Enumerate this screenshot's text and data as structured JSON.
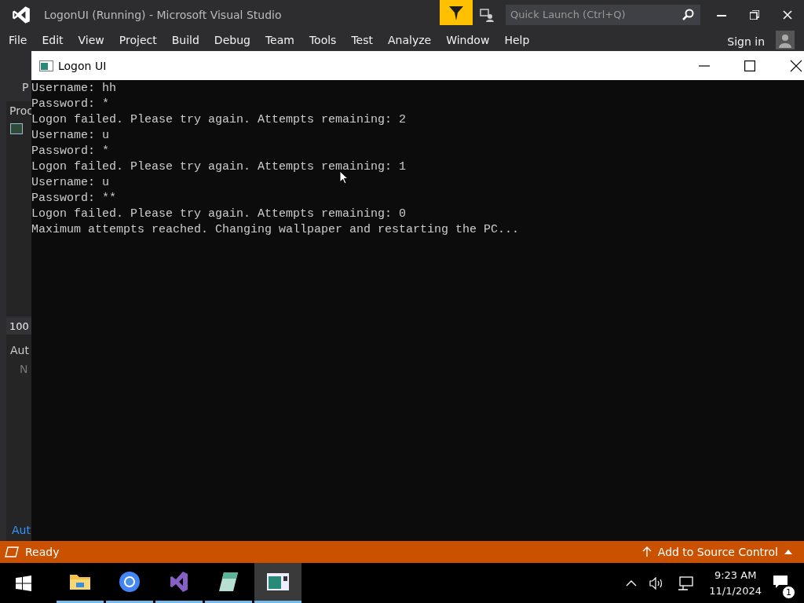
{
  "ide_window": {
    "title": "LogonUI (Running) - Microsoft Visual Studio",
    "quick_launch": {
      "placeholder": "Quick Launch (Ctrl+Q)"
    },
    "menu": [
      "File",
      "Edit",
      "View",
      "Project",
      "Build",
      "Debug",
      "Team",
      "Tools",
      "Test",
      "Analyze",
      "Window",
      "Help"
    ],
    "sign_in": "Sign in",
    "side_panel": {
      "toolbar_text": "P",
      "tab": "Proc",
      "zoom": "100",
      "autos_title": "Aut",
      "column": "N",
      "bottom_tab": "Aut"
    },
    "status_bar": {
      "text": "Ready",
      "source_control": "Add to Source Control"
    }
  },
  "console": {
    "title": "Logon UI",
    "lines": [
      "Username: hh",
      "Password: *",
      "Logon failed. Please try again. Attempts remaining: 2",
      "Username: u",
      "Password: *",
      "Logon failed. Please try again. Attempts remaining: 1",
      "Username: u",
      "Password: **",
      "Logon failed. Please try again. Attempts remaining: 0",
      "Maximum attempts reached. Changing wallpaper and restarting the PC..."
    ]
  },
  "taskbar": {
    "apps": [
      {
        "kind": "folder",
        "selected": false
      },
      {
        "kind": "browser",
        "selected": false
      },
      {
        "kind": "ide",
        "selected": false
      },
      {
        "kind": "notepad",
        "selected": false
      },
      {
        "kind": "console",
        "selected": true
      }
    ],
    "time": "9:23 AM",
    "date": "11/1/2024",
    "notifications": "1"
  }
}
